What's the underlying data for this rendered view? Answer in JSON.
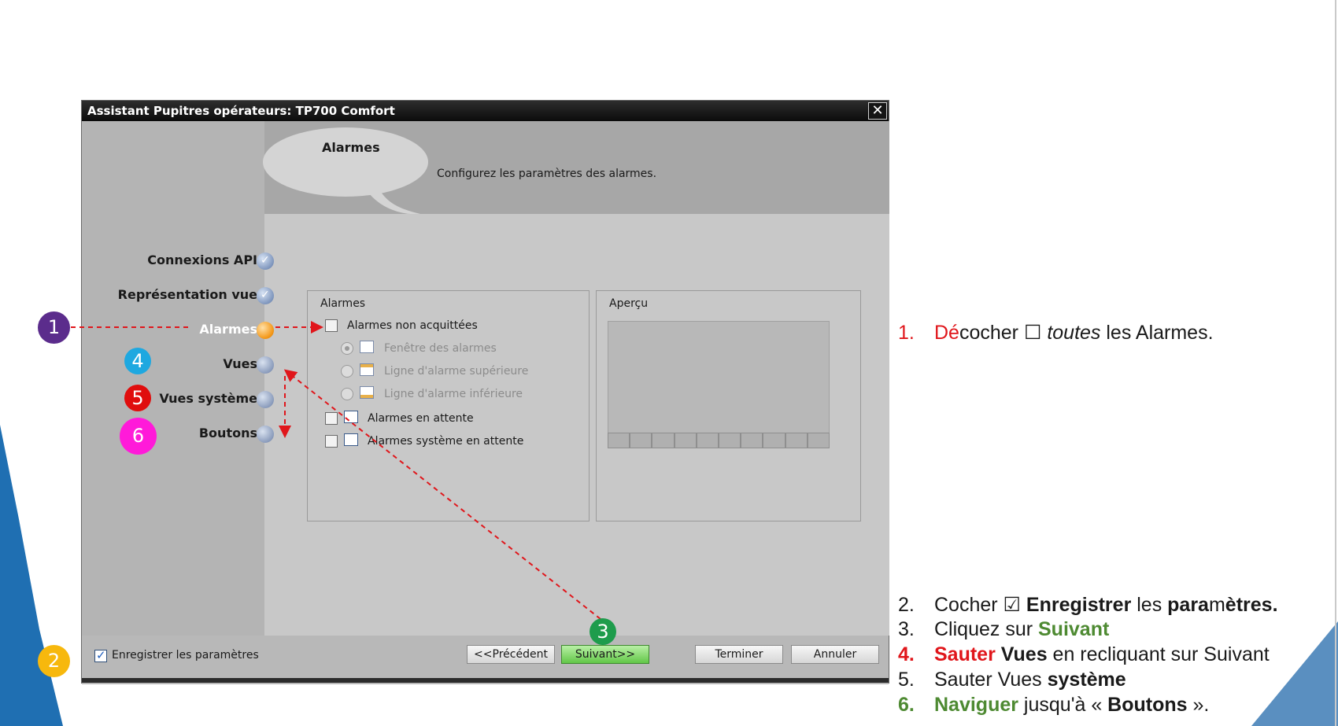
{
  "dialog": {
    "title": "Assistant Pupitres opérateurs: TP700 Comfort",
    "close_glyph": "✕",
    "header": {
      "bubble_title": "Alarmes",
      "description": "Configurez les paramètres des alarmes."
    },
    "nav": {
      "items": [
        {
          "label": "Connexions API",
          "state": "done"
        },
        {
          "label": "Représentation vue",
          "state": "done"
        },
        {
          "label": "Alarmes",
          "state": "active"
        },
        {
          "label": "Vues",
          "state": "todo"
        },
        {
          "label": "Vues système",
          "state": "todo"
        },
        {
          "label": "Boutons",
          "state": "todo"
        }
      ]
    },
    "alarms_group": {
      "title": "Alarmes",
      "options": [
        {
          "label": "Alarmes non acquittées",
          "control": "checkbox",
          "checked": false,
          "enabled": true
        },
        {
          "label": "Fenêtre des alarmes",
          "control": "radio",
          "selected": true,
          "enabled": false,
          "icon": "alarm-window-icon"
        },
        {
          "label": "Ligne d'alarme supérieure",
          "control": "radio",
          "selected": false,
          "enabled": false,
          "icon": "alarm-line-top-icon"
        },
        {
          "label": "Ligne d'alarme inférieure",
          "control": "radio",
          "selected": false,
          "enabled": false,
          "icon": "alarm-line-bottom-icon"
        },
        {
          "label": "Alarmes en attente",
          "control": "checkbox",
          "checked": false,
          "enabled": true,
          "icon": "alarm-window-icon"
        },
        {
          "label": "Alarmes système en attente",
          "control": "checkbox",
          "checked": false,
          "enabled": true,
          "icon": "alarm-window-icon"
        }
      ]
    },
    "preview_group": {
      "title": "Aperçu",
      "cell_count": 10
    },
    "footer": {
      "save_settings_label": "Enregistrer les paramètres",
      "save_settings_checked": true,
      "buttons": {
        "previous": "<<Précédent",
        "next": "Suivant>>",
        "finish": "Terminer",
        "cancel": "Annuler"
      }
    }
  },
  "badges": [
    {
      "number": "1",
      "color": "#5b2c8c"
    },
    {
      "number": "2",
      "color": "#f7b80d"
    },
    {
      "number": "3",
      "color": "#1e9c4c"
    },
    {
      "number": "4",
      "color": "#1ea8e0"
    },
    {
      "number": "5",
      "color": "#e00d0d"
    },
    {
      "number": "6",
      "color": "#ff1ad9"
    }
  ],
  "colors": {
    "accent_red": "#e0161b",
    "accent_green": "#4e8a32",
    "annotation_arrow": "#e0161b",
    "slide_blue": "#1f6fb2"
  },
  "instructions": {
    "step1": {
      "num": "1.",
      "p1": "Dé",
      "p2": "cocher ☐ ",
      "p3": "toutes",
      "p4": " les Alarmes."
    },
    "step2": {
      "num": "2.",
      "p1": "Cocher ☑ ",
      "p2": "Enregistrer",
      "p3": " les ",
      "p4": "para",
      "p5": "m",
      "p6": "ètres."
    },
    "step3": {
      "num": "3.",
      "p1": "Cliquez sur ",
      "p2": "Suivant"
    },
    "step4": {
      "num": "4.",
      "p1": "Sauter",
      "p2": " ",
      "p3": "Vues",
      "p4": " en recliquant sur Suivant"
    },
    "step5": {
      "num": "5.",
      "p1": "Sauter Vues ",
      "p2": "système"
    },
    "step6": {
      "num": "6.",
      "p1": "Naviguer",
      "p2": " jusqu'à « ",
      "p3": "Boutons",
      "p4": " »."
    }
  }
}
